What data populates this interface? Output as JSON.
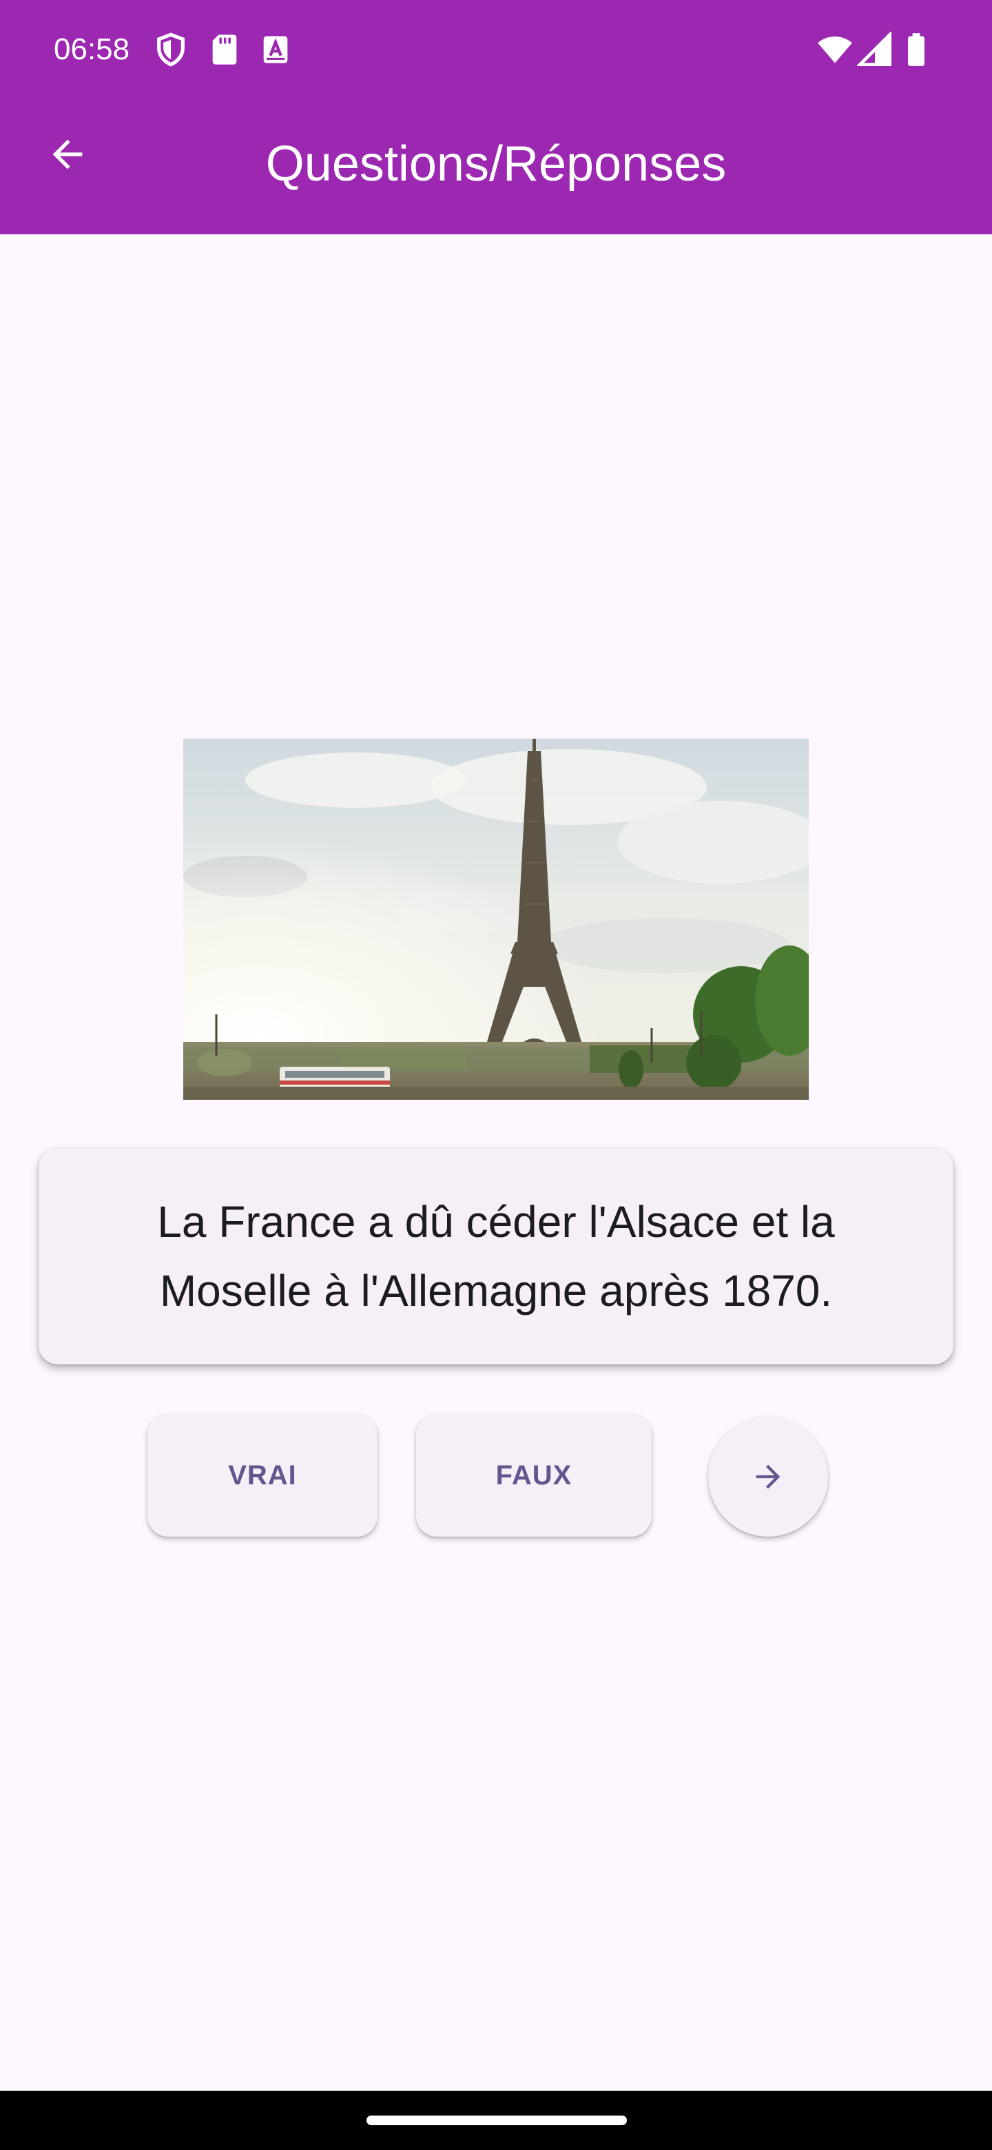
{
  "status_bar": {
    "time": "06:58",
    "left_icons": [
      "shield-icon",
      "sd-card-icon",
      "text-a-icon"
    ],
    "right_icons": [
      "wifi-icon",
      "signal-icon",
      "battery-icon"
    ]
  },
  "app_bar": {
    "title": "Questions/Réponses",
    "back_icon": "arrow-back-icon",
    "color": "#9C27B0"
  },
  "question": {
    "image": "eiffel-tower-photo",
    "text": "La France a dû céder l'Alsace et la Moselle à l'Allemagne après 1870."
  },
  "actions": {
    "true_label": "VRAI",
    "false_label": "FAUX",
    "next_icon": "arrow-forward-icon",
    "accent": "#65558F"
  },
  "theme": {
    "background": "#FEF7FF",
    "surface": "#F6EFF7"
  }
}
